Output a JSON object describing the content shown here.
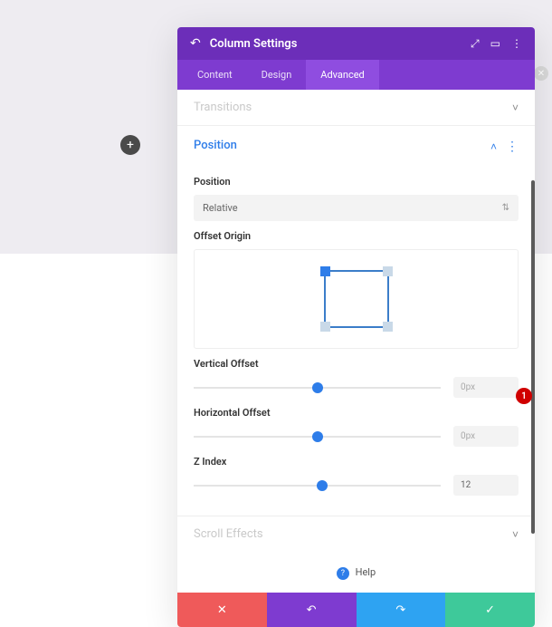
{
  "canvas": {
    "add_icon": "+"
  },
  "modal": {
    "back_icon": "↶",
    "title": "Column Settings",
    "header_actions": {
      "expand_icon": "⤢",
      "panel_icon": "▭",
      "more_icon": "⋮"
    },
    "tabs": {
      "content": "Content",
      "design": "Design",
      "advanced": "Advanced"
    },
    "sections": {
      "transitions": {
        "title": "Transitions",
        "chev": "˅"
      },
      "position": {
        "title": "Position",
        "chev": "˄",
        "more": "⋮",
        "fields": {
          "position": {
            "label": "Position",
            "value": "Relative"
          },
          "offset_origin": {
            "label": "Offset Origin"
          },
          "vertical_offset": {
            "label": "Vertical Offset",
            "value": "0px",
            "slider_pos": "50%"
          },
          "horizontal_offset": {
            "label": "Horizontal Offset",
            "value": "0px",
            "slider_pos": "50%"
          },
          "z_index": {
            "label": "Z Index",
            "value": "12",
            "slider_pos": "52%"
          }
        }
      },
      "scroll_effects": {
        "title": "Scroll Effects",
        "chev": "˅"
      }
    },
    "help": {
      "icon": "?",
      "label": "Help"
    },
    "footer": {
      "cancel_icon": "✕",
      "undo_icon": "↶",
      "redo_icon": "↷",
      "confirm_icon": "✓"
    }
  },
  "callout": {
    "label": "1"
  },
  "colors": {
    "accent_purple": "#7e3bd0",
    "accent_blue": "#2e7de9",
    "danger": "#ef5a5a",
    "success": "#3ec99a"
  }
}
